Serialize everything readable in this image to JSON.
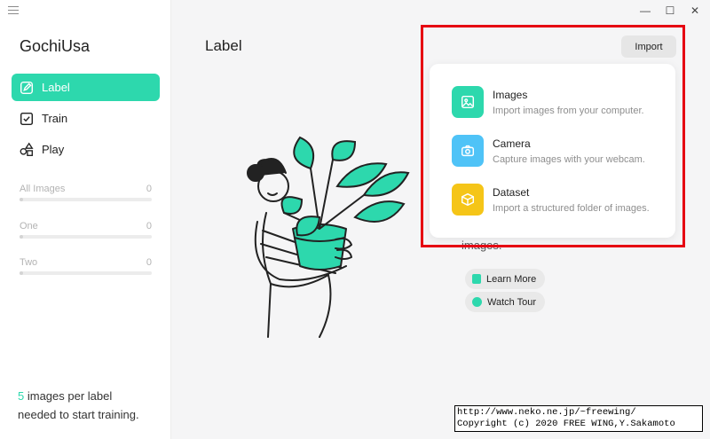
{
  "app": {
    "title": "GochiUsa",
    "window_controls": [
      "—",
      "☐",
      "✕"
    ]
  },
  "sidebar": {
    "nav": [
      {
        "label": "Label",
        "icon": "edit-icon",
        "active": true
      },
      {
        "label": "Train",
        "icon": "checkbox-icon",
        "active": false
      },
      {
        "label": "Play",
        "icon": "shapes-icon",
        "active": false
      }
    ],
    "categories": [
      {
        "name": "All Images",
        "count": "0"
      },
      {
        "name": "One",
        "count": "0"
      },
      {
        "name": "Two",
        "count": "0"
      }
    ],
    "note": {
      "number": "5",
      "text_a": " images per label",
      "text_b": "needed to start training."
    }
  },
  "main": {
    "title": "Label",
    "import_label": "Import",
    "dropdown": [
      {
        "title": "Images",
        "subtitle": "Import images from your computer.",
        "icon": "image-icon",
        "color": "#2dd8ad"
      },
      {
        "title": "Camera",
        "subtitle": "Capture images with your webcam.",
        "icon": "camera-icon",
        "color": "#4fc3f7"
      },
      {
        "title": "Dataset",
        "subtitle": "Import a structured folder of images.",
        "icon": "box-icon",
        "color": "#f5c518"
      }
    ],
    "hint": "images.",
    "learn_more": "Learn More",
    "watch_tour": "Watch Tour"
  },
  "overlay": {
    "line1": "http://www.neko.ne.jp/~freewing/",
    "line2": "Copyright (c) 2020 FREE WING,Y.Sakamoto"
  },
  "colors": {
    "accent": "#2dd8ad",
    "highlight": "#e60012"
  }
}
